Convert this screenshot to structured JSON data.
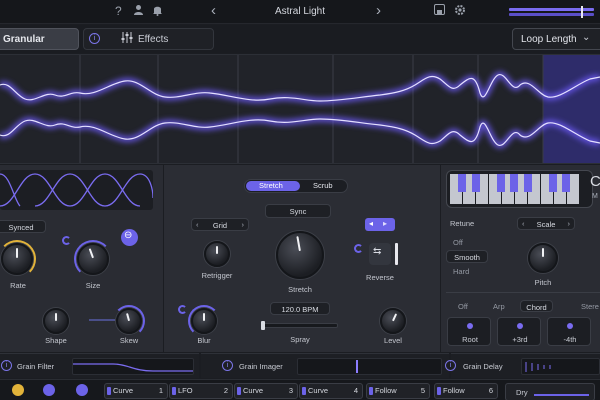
{
  "topbar": {
    "help_icon": "question-icon",
    "user_icon": "user-icon",
    "bell_icon": "bell-icon",
    "prev": "‹",
    "next": "›",
    "preset_name": "Astral Light",
    "save_icon": "save-icon",
    "gear_icon": "gear-icon"
  },
  "tabs": {
    "granular": "Granular",
    "effects": "Effects",
    "effects_info": "i",
    "loop_length": "Loop Length"
  },
  "grain_shape": {
    "sync_mode": "Synced",
    "rate_label": "Rate",
    "size_label": "Size",
    "shape_label": "Shape",
    "skew_label": "Skew"
  },
  "stretch": {
    "mode_stretch": "Stretch",
    "mode_scrub": "Scrub",
    "sync_label": "Sync",
    "grid_label": "Grid",
    "retrigger_label": "Retrigger",
    "stretch_label": "Stretch",
    "reverse_label": "Reverse",
    "bpm_value": "120.0 BPM",
    "spray_label": "Spray",
    "blur_label": "Blur",
    "level_label": "Level"
  },
  "pitch": {
    "retune_label": "Retune",
    "scale_label": "Scale",
    "retune_options": [
      "Off",
      "Smooth",
      "Hard"
    ],
    "retune_selected": "Smooth",
    "pitch_label": "Pitch",
    "mode_off": "Off",
    "mode_arp": "Arp",
    "mode_chord": "Chord",
    "mode_stereo": "Stere",
    "chord_root": "Root",
    "chord_third": "+3rd",
    "chord_fourth": "-4th",
    "side_letter": "C",
    "side_letter2": "M"
  },
  "strips": {
    "grain_filter": "Grain Filter",
    "grain_imager": "Grain Imager",
    "grain_delay": "Grain Delay"
  },
  "mod_slots": [
    {
      "name": "Curve",
      "num": "1"
    },
    {
      "name": "LFO",
      "num": "2"
    },
    {
      "name": "Curve",
      "num": "3"
    },
    {
      "name": "Curve",
      "num": "4"
    },
    {
      "name": "Follow",
      "num": "5"
    },
    {
      "name": "Follow",
      "num": "6"
    }
  ],
  "dry_label": "Dry",
  "colors": {
    "accent": "#6c63e8",
    "wave": "#8c7dff",
    "panel": "#2a2c33"
  }
}
